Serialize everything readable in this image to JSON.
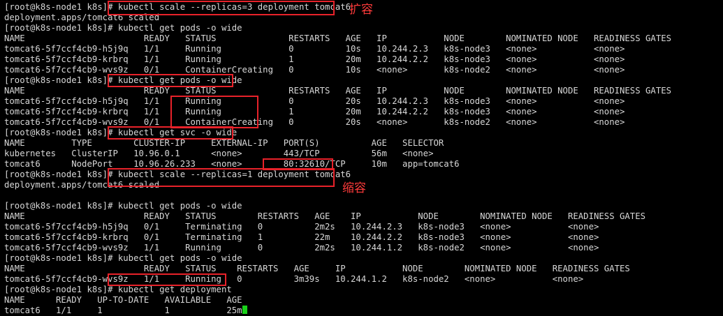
{
  "terminal": {
    "lines": [
      "[root@k8s-node1 k8s]# kubectl scale --replicas=3 deployment tomcat6",
      "deployment.apps/tomcat6 scaled",
      "[root@k8s-node1 k8s]# kubectl get pods -o wide",
      "NAME                       READY   STATUS              RESTARTS   AGE   IP           NODE        NOMINATED NODE   READINESS GATES",
      "tomcat6-5f7ccf4cb9-h5j9q   1/1     Running             0          10s   10.244.2.3   k8s-node3   <none>           <none>",
      "tomcat6-5f7ccf4cb9-krbrq   1/1     Running             1          20m   10.244.2.2   k8s-node3   <none>           <none>",
      "tomcat6-5f7ccf4cb9-wvs9z   0/1     ContainerCreating   0          10s   <none>       k8s-node2   <none>           <none>",
      "[root@k8s-node1 k8s]# kubectl get pods -o wide",
      "NAME                       READY   STATUS              RESTARTS   AGE   IP           NODE        NOMINATED NODE   READINESS GATES",
      "tomcat6-5f7ccf4cb9-h5j9q   1/1     Running             0          20s   10.244.2.3   k8s-node3   <none>           <none>",
      "tomcat6-5f7ccf4cb9-krbrq   1/1     Running             1          20m   10.244.2.2   k8s-node3   <none>           <none>",
      "tomcat6-5f7ccf4cb9-wvs9z   0/1     ContainerCreating   0          20s   <none>       k8s-node2   <none>           <none>",
      "[root@k8s-node1 k8s]# kubectl get svc -o wide",
      "NAME         TYPE        CLUSTER-IP     EXTERNAL-IP   PORT(S)          AGE   SELECTOR",
      "kubernetes   ClusterIP   10.96.0.1      <none>        443/TCP          56m   <none>",
      "tomcat6      NodePort    10.96.26.233   <none>        80:32610/TCP     10m   app=tomcat6",
      "[root@k8s-node1 k8s]# kubectl scale --replicas=1 deployment tomcat6",
      "deployment.apps/tomcat6 scaled",
      "[root@k8s-node1 k8s]# kubectl get pods -o wide",
      "NAME                       READY   STATUS        RESTARTS   AGE    IP           NODE        NOMINATED NODE   READINESS GATES",
      "tomcat6-5f7ccf4cb9-h5j9q   0/1     Terminating   0          2m2s   10.244.2.3   k8s-node3   <none>           <none>",
      "tomcat6-5f7ccf4cb9-krbrq   0/1     Terminating   1          22m    10.244.2.2   k8s-node3   <none>           <none>",
      "tomcat6-5f7ccf4cb9-wvs9z   1/1     Running       0          2m2s   10.244.1.2   k8s-node2   <none>           <none>",
      "[root@k8s-node1 k8s]# kubectl get pods -o wide",
      "NAME                       READY   STATUS    RESTARTS   AGE     IP           NODE        NOMINATED NODE   READINESS GATES",
      "tomcat6-5f7ccf4cb9-wvs9z   1/1     Running   0          3m39s   10.244.1.2   k8s-node2   <none>           <none>",
      "[root@k8s-node1 k8s]# kubectl get deployment",
      "NAME      READY   UP-TO-DATE   AVAILABLE   AGE",
      "tomcat6   1/1     1            1           25m"
    ],
    "text_color": "#d8d8d8",
    "background_color": "#000000",
    "cursor_color": "#19d219"
  },
  "annotations": {
    "scale_up_label": "扩容",
    "scale_down_label": "缩容",
    "highlight_color": "#e8222a"
  }
}
